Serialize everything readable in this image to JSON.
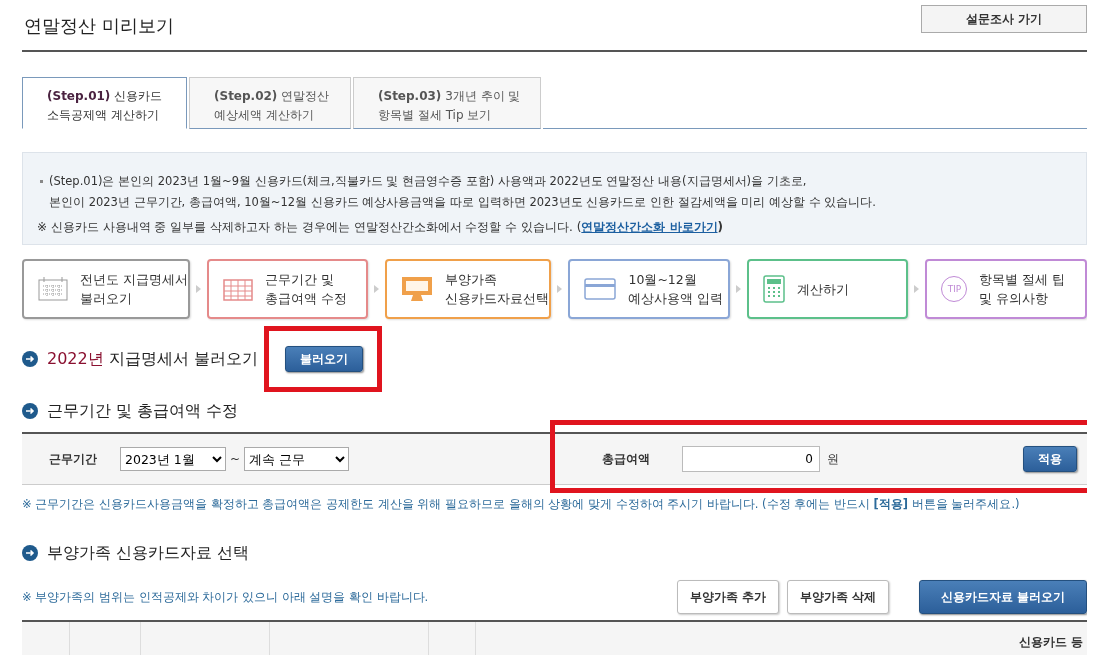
{
  "page": {
    "title": "연말정산 미리보기",
    "survey_button": "설문조사 가기"
  },
  "tabs": [
    {
      "step": "(Step.01)",
      "line1": "신용카드",
      "line2": "소득공제액 계산하기",
      "selected": true
    },
    {
      "step": "(Step.02)",
      "line1": "연말정산",
      "line2": "예상세액 계산하기",
      "selected": false
    },
    {
      "step": "(Step.03)",
      "line1": "3개년 추이 및",
      "line2": "항목별 절세 Tip 보기",
      "selected": false
    }
  ],
  "info": {
    "lines": [
      "(Step.01)은 본인의 2023년 1월~9월 신용카드(체크,직불카드 및 현금영수증 포함) 사용액과 2022년도 연말정산 내용(지급명세서)을 기초로,",
      "본인이 2023년 근무기간, 총급여액, 10월~12월 신용카드 예상사용금액을 따로 입력하면 2023년도 신용카드로 인한 절감세액을 미리 예상할 수 있습니다."
    ],
    "note": "※ 신용카드 사용내역 중 일부를 삭제하고자 하는 경우에는 연말정산간소화에서 수정할 수 있습니다. (",
    "link": "연말정산간소화 바로가기",
    "note_end": ")"
  },
  "steps": [
    {
      "kind": "calendar",
      "color": "#999999",
      "line1": "전년도 지급명세서",
      "line2": "불러오기"
    },
    {
      "kind": "grid",
      "color": "#e58a8a",
      "line1": "근무기간 및",
      "line2": "총급여액 수정"
    },
    {
      "kind": "monitor",
      "color": "#f0a04a",
      "line1": "부양가족",
      "line2": "신용카드자료선택"
    },
    {
      "kind": "card",
      "color": "#8aa6d6",
      "line1": "10월~12월",
      "line2": "예상사용액 입력"
    },
    {
      "kind": "calculator",
      "color": "#5cc08a",
      "line1": "계산하기"
    },
    {
      "kind": "tip",
      "color": "#c08ad6",
      "icon_text": "TIP",
      "line1": "항목별 절세 팁",
      "line2": "및 유의사항"
    }
  ],
  "section1": {
    "year": "2022년",
    "title": "지급명세서 불러오기",
    "button": "불러오기",
    "highlighted": true
  },
  "section2": {
    "title": "근무기간 및 총급여액 수정",
    "period_label": "근무기간",
    "start": "2023년 1월",
    "tilde": "~",
    "end": "계속 근무",
    "salary_label": "총급여액",
    "salary_value": "0",
    "unit": "원",
    "apply_button": "적용",
    "highlighted": true,
    "note": "※ 근무기간은 신용카드사용금액을 확정하고 총급여액은 공제한도 계산을 위해 필요하므로 올해의 상황에 맞게 수정하여 주시기 바랍니다. (수정 후에는 반드시 **[적용]** 버튼을 눌러주세요.)"
  },
  "section3": {
    "title": "부양가족 신용카드자료 선택",
    "note": "※ 부양가족의 범위는 인적공제와 차이가 있으니 아래 설명을 확인 바랍니다.",
    "buttons": [
      "부양가족 추가",
      "부양가족 삭제"
    ],
    "load_button": "신용카드자료 불러오기"
  },
  "table": {
    "column_6": "신용카드 등"
  }
}
